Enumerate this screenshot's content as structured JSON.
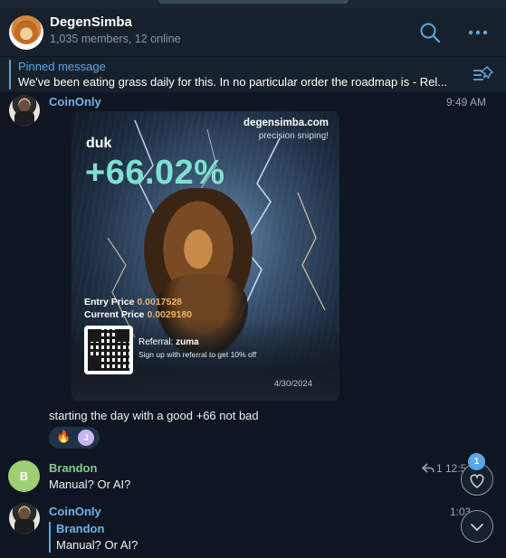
{
  "chat": {
    "title": "DegenSimba",
    "subtitle": "1,035 members, 12 online"
  },
  "pinned": {
    "label": "Pinned message",
    "text": "We've been eating grass daily for this. In no particular order the roadmap is - Rel..."
  },
  "messages": [
    {
      "sender": "CoinOnly",
      "time": "9:49 AM",
      "photo": {
        "site": "degensimba.com",
        "tagline": "precision sniping!",
        "ticker": "duk",
        "gain": "+66.02%",
        "entry_label": "Entry Price",
        "entry_value": "0.0017528",
        "current_label": "Current Price",
        "current_value": "0.0029180",
        "referral_label": "Referral:",
        "referral_code": "zuma",
        "referral_note": "Sign up with referral to get 10% off",
        "date": "4/30/2024"
      },
      "text": "starting the day with a good +66 not bad",
      "reactions": {
        "emoji": "🔥",
        "avatar_letter": "J"
      }
    },
    {
      "sender": "Brandon",
      "avatar_letter": "B",
      "time": "1 12:5",
      "text": "Manual? Or AI?"
    },
    {
      "sender": "CoinOnly",
      "time": "1:03",
      "reply_to": {
        "name": "Brandon",
        "text": "Manual? Or AI?"
      }
    }
  ],
  "overlay": {
    "unread_count": "1"
  },
  "colors": {
    "accent": "#5aa7e6",
    "gain": "#7ee0d0",
    "price": "#f2b35a"
  }
}
